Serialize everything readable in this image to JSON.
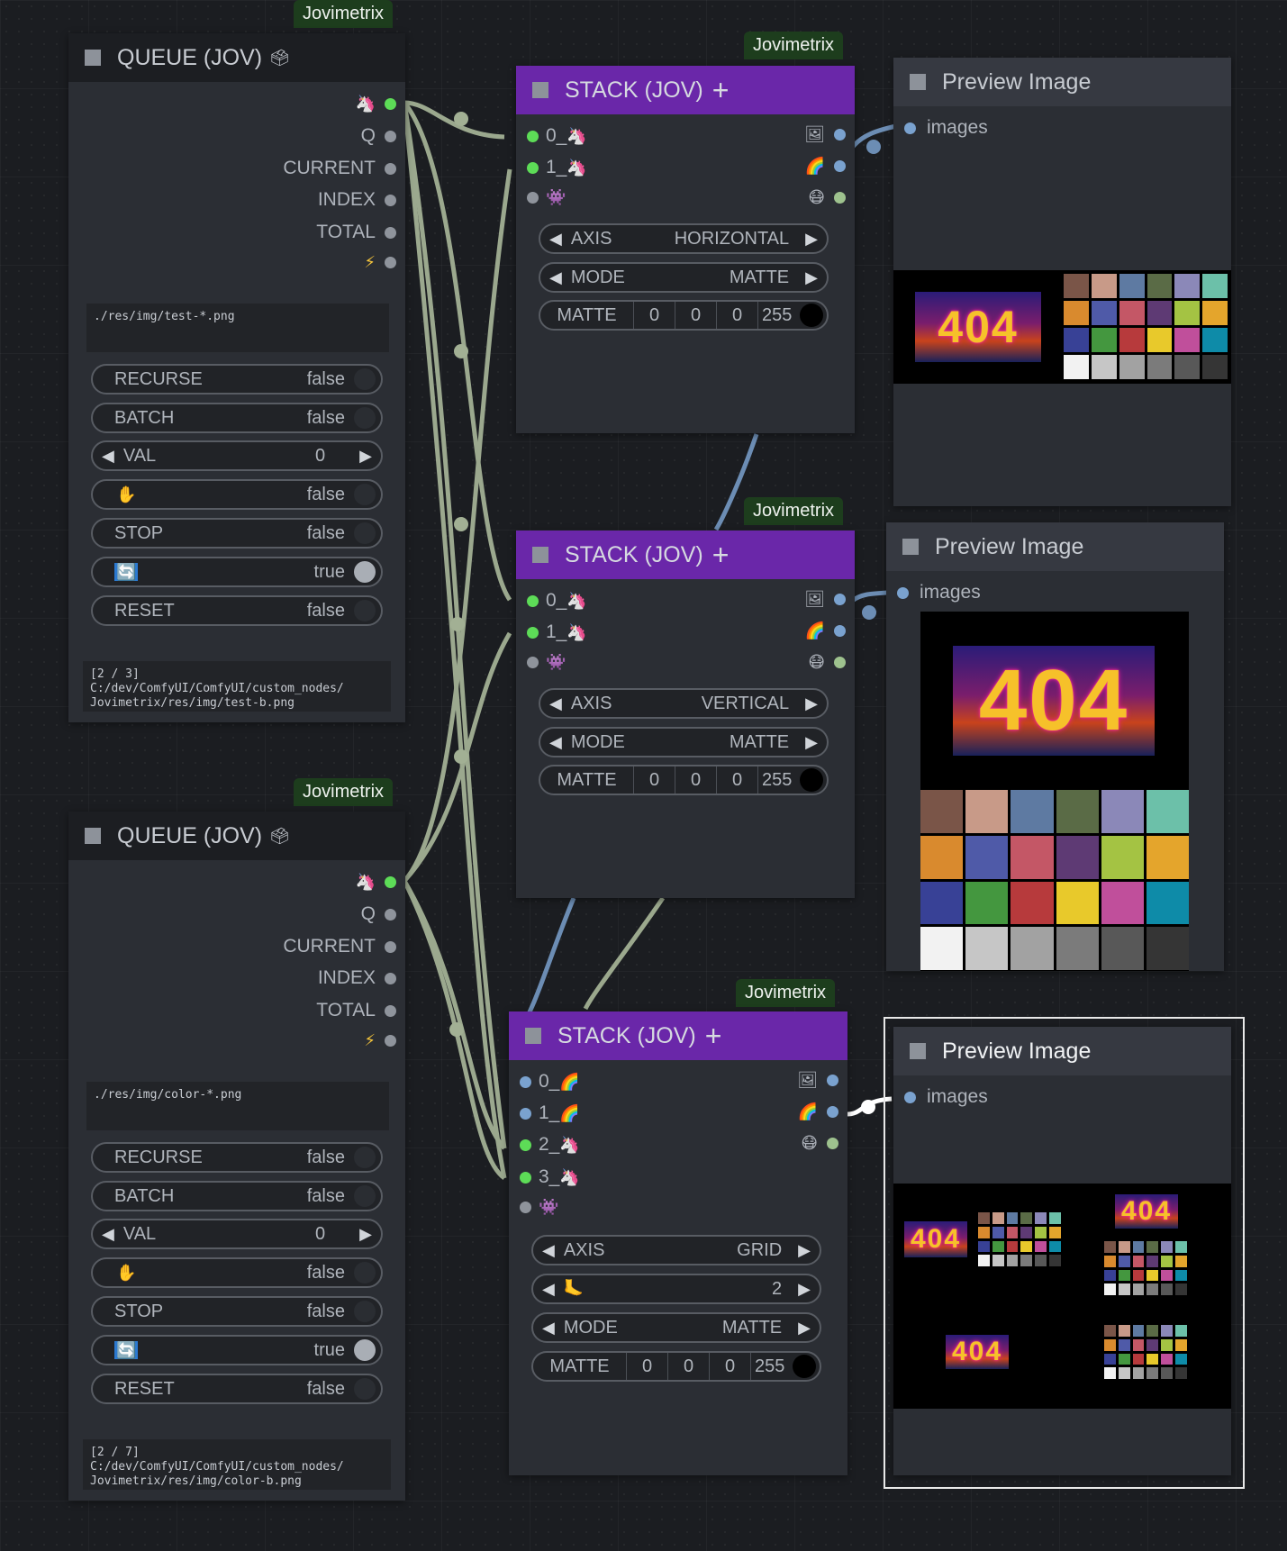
{
  "brand": "Jovimetrix",
  "queue_title": "QUEUE (JOV)",
  "stack_title": "STACK (JOV)",
  "preview_title": "Preview Image",
  "preview_input": "images",
  "queue_outputs": [
    "Q",
    "CURRENT",
    "INDEX",
    "TOTAL"
  ],
  "queues": [
    {
      "path": "./res/img/test-*.png",
      "widgets": {
        "recurse": "RECURSE",
        "recurse_val": "false",
        "batch": "BATCH",
        "batch_val": "false",
        "val": "VAL",
        "val_val": "0",
        "hold_val": "false",
        "stop": "STOP",
        "stop_val": "false",
        "loop_val": "true",
        "reset": "RESET",
        "reset_val": "false"
      },
      "status": "[2 / 3]\nC:/dev/ComfyUI/ComfyUI/custom_nodes/\nJovimetrix/res/img/test-b.png"
    },
    {
      "path": "./res/img/color-*.png",
      "widgets": {
        "recurse": "RECURSE",
        "recurse_val": "false",
        "batch": "BATCH",
        "batch_val": "false",
        "val": "VAL",
        "val_val": "0",
        "hold_val": "false",
        "stop": "STOP",
        "stop_val": "false",
        "loop_val": "true",
        "reset": "RESET",
        "reset_val": "false"
      },
      "status": "[2 / 7]\nC:/dev/ComfyUI/ComfyUI/custom_nodes/\nJovimetrix/res/img/color-b.png"
    }
  ],
  "stacks": [
    {
      "inputs": [
        "0_",
        "1_"
      ],
      "axis_label": "AXIS",
      "axis": "HORIZONTAL",
      "mode_label": "MODE",
      "mode": "MATTE",
      "matte_label": "MATTE",
      "matte": [
        "0",
        "0",
        "0",
        "255"
      ]
    },
    {
      "inputs": [
        "0_",
        "1_"
      ],
      "axis_label": "AXIS",
      "axis": "VERTICAL",
      "mode_label": "MODE",
      "mode": "MATTE",
      "matte_label": "MATTE",
      "matte": [
        "0",
        "0",
        "0",
        "255"
      ]
    },
    {
      "inputs": [
        "0_",
        "1_",
        "2_",
        "3_"
      ],
      "axis_label": "AXIS",
      "axis": "GRID",
      "stride": "2",
      "mode_label": "MODE",
      "mode": "MATTE",
      "matte_label": "MATTE",
      "matte": [
        "0",
        "0",
        "0",
        "255"
      ]
    }
  ],
  "logo_text": "404",
  "palette": [
    "#7a5548",
    "#c89a88",
    "#5e7aa2",
    "#5a6b46",
    "#8b88b8",
    "#6cc0a9",
    "#d98a2e",
    "#4f5aa8",
    "#c45766",
    "#5e3a74",
    "#a4c343",
    "#e4a52c",
    "#384196",
    "#44973f",
    "#b73a3c",
    "#e8c92b",
    "#c04f9b",
    "#0e8ba8",
    "#f2f2f2",
    "#c6c6c6",
    "#a2a2a2",
    "#7b7b7b",
    "#585858",
    "#353535"
  ],
  "colors": {
    "purple": "#6a27a9",
    "badge": "#1d3d1d",
    "wire": "#9aaa8e",
    "wire_blue": "#6c8db4"
  }
}
